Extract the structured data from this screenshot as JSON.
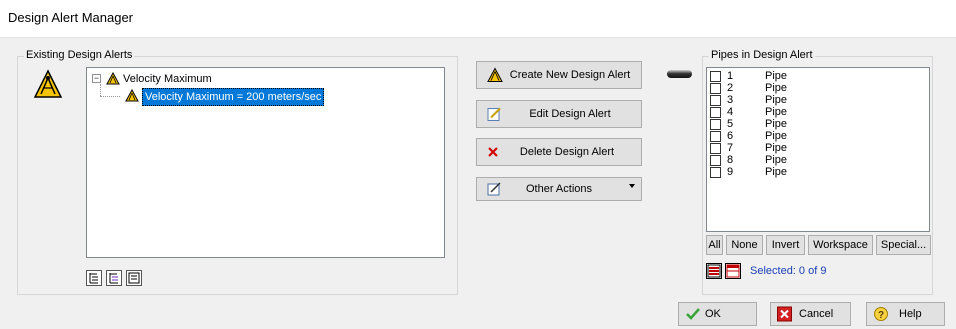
{
  "window": {
    "title": "Design Alert Manager"
  },
  "existing_alerts": {
    "group_label": "Existing Design Alerts",
    "tree": {
      "parent": {
        "label": "Velocity Maximum",
        "expander": "−"
      },
      "child": {
        "label": "Velocity Maximum = 200 meters/sec"
      }
    },
    "big_icon": "design-alert-icon",
    "bottom_icons": [
      "expand-all-icon",
      "collapse-all-icon",
      "tree-options-icon"
    ]
  },
  "actions": {
    "create_label": "Create New Design Alert",
    "edit_label": "Edit Design Alert",
    "delete_label": "Delete Design Alert",
    "other_label": "Other Actions"
  },
  "pipes": {
    "group_label": "Pipes in Design Alert",
    "items": [
      {
        "num": "1",
        "name": "Pipe"
      },
      {
        "num": "2",
        "name": "Pipe"
      },
      {
        "num": "3",
        "name": "Pipe"
      },
      {
        "num": "4",
        "name": "Pipe"
      },
      {
        "num": "5",
        "name": "Pipe"
      },
      {
        "num": "6",
        "name": "Pipe"
      },
      {
        "num": "7",
        "name": "Pipe"
      },
      {
        "num": "8",
        "name": "Pipe"
      },
      {
        "num": "9",
        "name": "Pipe"
      }
    ],
    "filter_buttons": {
      "all": "All",
      "none": "None",
      "invert": "Invert",
      "workspace": "Workspace",
      "special": "Special..."
    },
    "selected_text": "Selected: 0 of 9"
  },
  "footer": {
    "ok_label": "OK",
    "cancel_label": "Cancel",
    "help_label": "Help"
  },
  "colors": {
    "selection": "#0078d7",
    "warning_yellow": "#f5c400",
    "selected_text_blue": "#1a3fb5"
  }
}
